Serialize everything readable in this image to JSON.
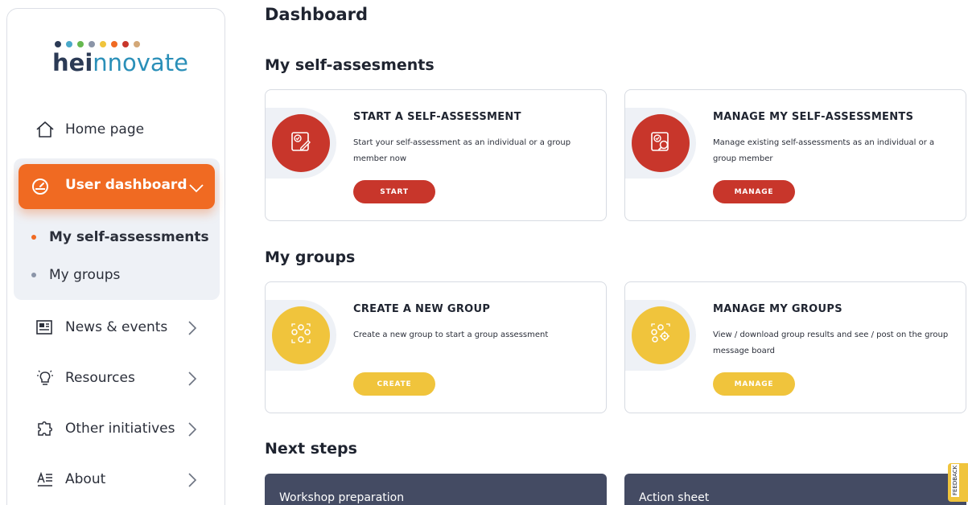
{
  "logo": {
    "part1": "hei",
    "part2": "nnovate",
    "dot_colors": [
      "#2b3a55",
      "#4aa9c9",
      "#66b84f",
      "#8b95a8",
      "#f0c43c",
      "#f06a22",
      "#c8362b",
      "#d3a878"
    ]
  },
  "sidebar": {
    "home": {
      "label": "Home page",
      "icon": "home-icon"
    },
    "dashboard": {
      "label": "User dashboard",
      "icon": "speedometer-icon"
    },
    "sub_items": [
      {
        "label": "My self-assessments",
        "active": true
      },
      {
        "label": "My groups",
        "active": false
      }
    ],
    "items": [
      {
        "label": "News & events",
        "icon": "newspaper-icon"
      },
      {
        "label": "Resources",
        "icon": "lightbulb-icon"
      },
      {
        "label": "Other initiatives",
        "icon": "puzzle-icon"
      },
      {
        "label": "About",
        "icon": "about-text-icon"
      }
    ]
  },
  "main": {
    "title": "Dashboard",
    "sections": {
      "self_assessments": "My self-assesments",
      "groups": "My groups",
      "next_steps": "Next steps"
    },
    "cards": {
      "start": {
        "title": "START A SELF-ASSESSMENT",
        "desc": "Start your self-assessment as an individual or a group member now",
        "button": "START"
      },
      "manage_sa": {
        "title": "MANAGE MY SELF-ASSESSMENTS",
        "desc": "Manage existing self-assessments as an individual or a group member",
        "button": "MANAGE"
      },
      "create_group": {
        "title": "CREATE A NEW GROUP",
        "desc": "Create a new group to start a group assessment",
        "button": "CREATE"
      },
      "manage_groups": {
        "title": "MANAGE MY GROUPS",
        "desc": "View / download group results and see / post on the group message board",
        "button": "MANAGE"
      }
    },
    "next_steps": [
      "Workshop preparation",
      "Action sheet"
    ]
  },
  "feedback_label": "FEEDBACK",
  "colors": {
    "accent": "#f06a22",
    "red": "#c8362b",
    "yellow": "#f0c43c",
    "navy": "#444b63"
  }
}
